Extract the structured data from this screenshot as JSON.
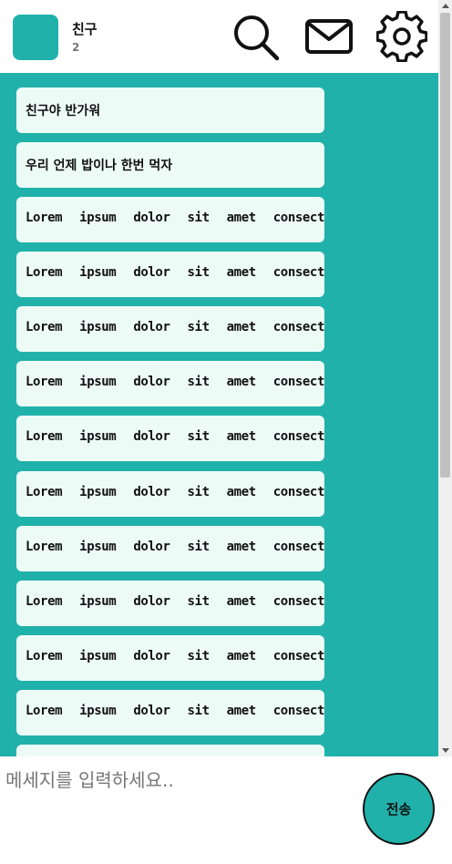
{
  "header": {
    "room_name": "친구",
    "member_count": "2",
    "icons": [
      "search-icon",
      "mail-icon",
      "settings-icon"
    ]
  },
  "messages": [
    {
      "text": "친구야 반가워"
    },
    {
      "text": "우리 언제 밥이나 한번 먹자"
    },
    {
      "text": "Lorem ipsum dolor sit amet consectetur"
    },
    {
      "text": "Lorem ipsum dolor sit amet consectetur"
    },
    {
      "text": "Lorem ipsum dolor sit amet consectetur"
    },
    {
      "text": "Lorem ipsum dolor sit amet consectetur"
    },
    {
      "text": "Lorem ipsum dolor sit amet consectetur"
    },
    {
      "text": "Lorem ipsum dolor sit amet consectetur"
    },
    {
      "text": "Lorem ipsum dolor sit amet consectetur"
    },
    {
      "text": "Lorem ipsum dolor sit amet consectetur"
    },
    {
      "text": "Lorem ipsum dolor sit amet consectetur"
    },
    {
      "text": "Lorem ipsum dolor sit amet consectetur"
    }
  ],
  "composer": {
    "placeholder": "메세지를 입력하세요..",
    "send_label": "전송"
  },
  "colors": {
    "accent": "#20b2aa",
    "bubble": "#edfbf7"
  }
}
